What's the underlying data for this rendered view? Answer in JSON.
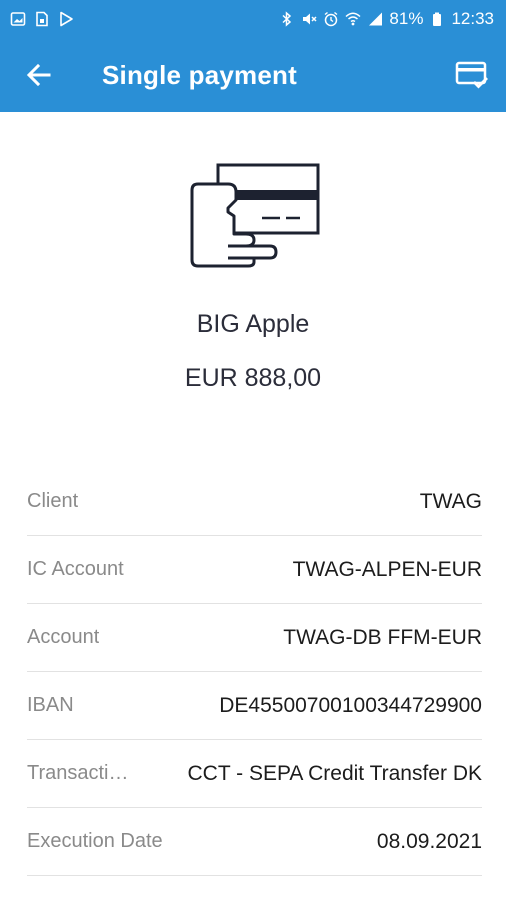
{
  "status_bar": {
    "battery": "81%",
    "time": "12:33",
    "left_icons": [
      "image-icon",
      "sim-card-icon",
      "play-store-icon"
    ],
    "right_icons": [
      "bluetooth-icon",
      "mute-icon",
      "alarm-icon",
      "wifi-icon",
      "signal-icon",
      "battery-icon"
    ]
  },
  "app_bar": {
    "title": "Single payment",
    "back_icon": "arrow-left-icon",
    "action_icon": "card-check-icon",
    "color": "#2a8fd6"
  },
  "payment": {
    "illustration": "hand-card-icon",
    "payee": "BIG Apple",
    "amount": "EUR 888,00"
  },
  "details": [
    {
      "label": "Client",
      "value": "TWAG"
    },
    {
      "label": "IC Account",
      "value": "TWAG-ALPEN-EUR"
    },
    {
      "label": "Account",
      "value": "TWAG-DB FFM-EUR"
    },
    {
      "label": "IBAN",
      "value": "DE45500700100344729900"
    },
    {
      "label": "Transaction Type",
      "value": "CCT - SEPA Credit Transfer DK"
    },
    {
      "label": "Execution Date",
      "value": "08.09.2021"
    }
  ]
}
